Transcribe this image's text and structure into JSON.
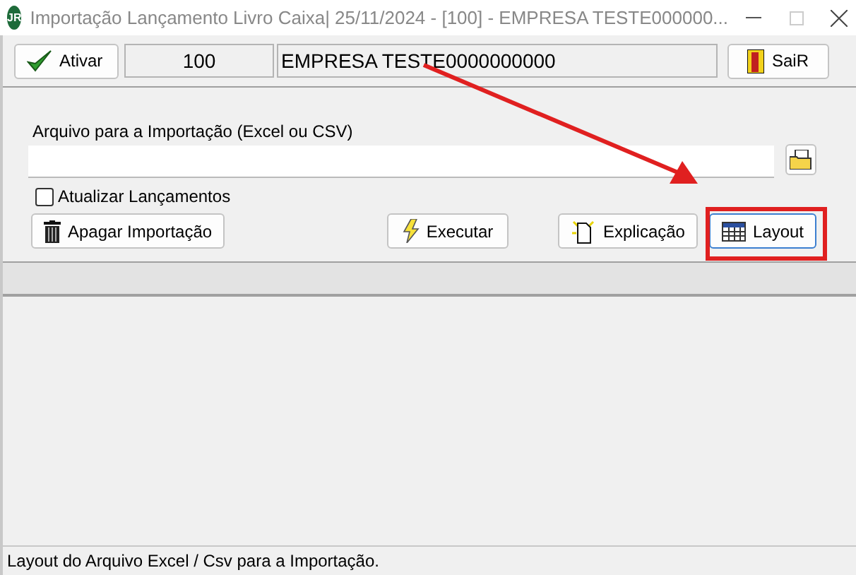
{
  "window": {
    "logo_text": "JR",
    "title": "Importação Lançamento Livro Caixa|  25/11/2024 - [100] - EMPRESA TESTE000000..."
  },
  "toolbar": {
    "activate_button": "Ativar",
    "company_code": "100",
    "company_name": "EMPRESA TESTE0000000000",
    "exit_button": "SaiR"
  },
  "form": {
    "file_label": "Arquivo para a Importação (Excel ou CSV)",
    "update_checkbox": {
      "label": "Atualizar Lançamentos",
      "checked": false
    }
  },
  "buttons": [
    {
      "kind": "delete",
      "label": "Apagar Importação"
    },
    {
      "kind": "run",
      "label": "Executar"
    },
    {
      "kind": "explain",
      "label": "Explicação"
    },
    {
      "kind": "layout",
      "label": "Layout"
    }
  ],
  "status_bar": "Layout do Arquivo Excel / Csv para a Importação."
}
